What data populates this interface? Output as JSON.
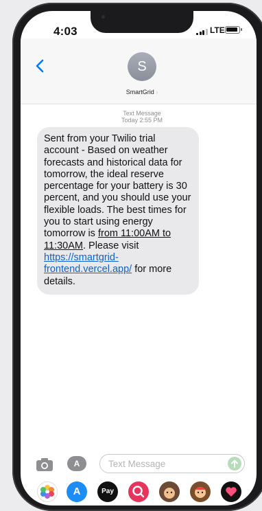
{
  "status_bar": {
    "time": "4:03",
    "network": "LTE",
    "signal_bars": 3,
    "battery_level": 0.8
  },
  "header": {
    "avatar_initial": "S",
    "contact_name": "SmartGrid",
    "chevron": "›"
  },
  "conversation": {
    "meta_type": "Text Message",
    "meta_time": "Today 2:55 PM",
    "message": {
      "part1": "Sent from your Twilio trial account - Based on weather forecasts and historical data for tomorrow, the ideal reserve percentage for your battery is 30 percent, and you should use your flexible loads. The best times for you to start using energy tomorrow is ",
      "underlined": "from 11:00AM to 11:30AM",
      "part2": ". Please visit ",
      "link": "https://smartgrid-frontend.vercel.app/",
      "part3": " for more details."
    }
  },
  "composer": {
    "placeholder": "Text Message",
    "apps_label": "A"
  },
  "dock": {
    "apps": [
      {
        "name": "photos-app-icon",
        "label": ""
      },
      {
        "name": "app-store-icon",
        "label": "A"
      },
      {
        "name": "apple-pay-icon",
        "label": "Pay"
      },
      {
        "name": "search-images-icon",
        "label": ""
      },
      {
        "name": "memoji-icon",
        "label": ""
      },
      {
        "name": "memoji-stickers-icon",
        "label": ""
      },
      {
        "name": "digital-touch-icon",
        "label": ""
      }
    ]
  },
  "colors": {
    "link": "#0a63d6",
    "bubble": "#e9e9eb",
    "accent": "#007aff"
  }
}
